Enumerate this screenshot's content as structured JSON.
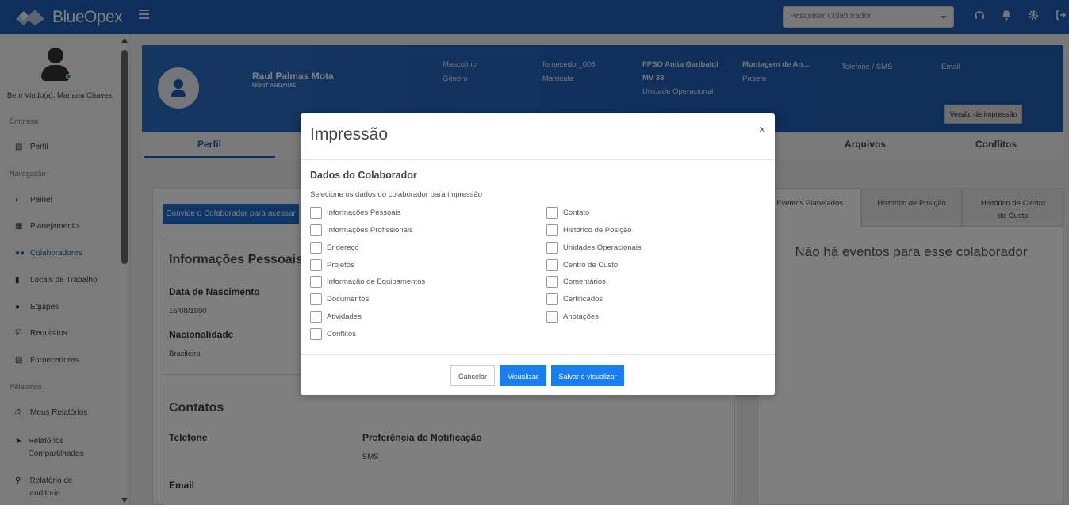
{
  "app": {
    "name": "BlueOpex"
  },
  "topbar": {
    "search_placeholder": "Pesquisar Colaborador"
  },
  "sidebar": {
    "welcome": "Bem Vindo(a), Mariana Chaves",
    "sections": {
      "empresa": "Empresa",
      "navegacao": "Navegação",
      "relatorios": "Relatórios"
    },
    "items": [
      {
        "label": "Perfil",
        "icon": "briefcase-icon"
      },
      {
        "label": "Painel",
        "icon": "dashboard-icon"
      },
      {
        "label": "Planejamento",
        "icon": "calendar-icon"
      },
      {
        "label": "Colaboradores",
        "icon": "users-icon",
        "active": true
      },
      {
        "label": "Locais de Trabalho",
        "icon": "building-icon"
      },
      {
        "label": "Equipes",
        "icon": "team-icon"
      },
      {
        "label": "Requisitos",
        "icon": "checkbox-icon"
      },
      {
        "label": "Fornecedores",
        "icon": "briefcase-icon"
      },
      {
        "label": "Meus Relatórios",
        "icon": "print-icon"
      },
      {
        "label": "Relatórios Compartilhados",
        "icon": "share-icon"
      },
      {
        "label": "Relatório de auditoria",
        "icon": "search-icon"
      }
    ]
  },
  "profile": {
    "name": "Raul Palmas Mota",
    "company": "MONT ANDAIME",
    "gender_value": "Masculino",
    "gender_label": "Gênero",
    "registration_value": "fornecedor_008",
    "registration_label": "Matrícula",
    "unit_value_line1": "FPSO Anita Garibaldi",
    "unit_value_line2": "MV 33",
    "unit_label": "Unidade Operacional",
    "project_value": "Montagem de An...",
    "project_label": "Projeto",
    "phone_label": "Telefone / SMS",
    "email_label": "Email",
    "print_version_button": "Versão de Impressão"
  },
  "tabs": {
    "perfil": "Perfil",
    "arquivos": "Arquivos",
    "conflitos": "Conflitos"
  },
  "left_panel": {
    "invite_button": "Convide o Colaborador para acessar",
    "section_personal": "Informações Pessoais",
    "birth_label": "Data de Nascimento",
    "birth_value": "16/08/1990",
    "nationality_label": "Nacionalidade",
    "nationality_value": "Brasileiro",
    "section_contacts": "Contatos",
    "phone_label": "Telefone",
    "notif_label": "Preferência de Notificação",
    "notif_value": "SMS",
    "email_label": "Email"
  },
  "right_panel": {
    "tab1": "Eventos Planejados",
    "tab2": "Histórico de Posição",
    "tab3_line1": "Histórico de Centro",
    "tab3_line2": "de Custo",
    "empty_message": "Não há eventos para esse colaborador"
  },
  "modal": {
    "title": "Impressão",
    "close": "×",
    "subtitle": "Dados do Colaborador",
    "description": "Selecione os dados do colaborador para impressão",
    "left_options": [
      "Informações Pessoais",
      "Informações Profissionais",
      "Endereço",
      "Projetos",
      "Informação de Equipamentos",
      "Documentos",
      "Atividades",
      "Conflitos"
    ],
    "right_options": [
      "Contato",
      "Histórico de Posição",
      "Unidades Operacionais",
      "Centro de Custo",
      "Comentários",
      "Certificados",
      "Anotações"
    ],
    "cancel_button": "Cancelar",
    "view_button": "Visualizar",
    "save_view_button": "Salvar e visualizar"
  }
}
